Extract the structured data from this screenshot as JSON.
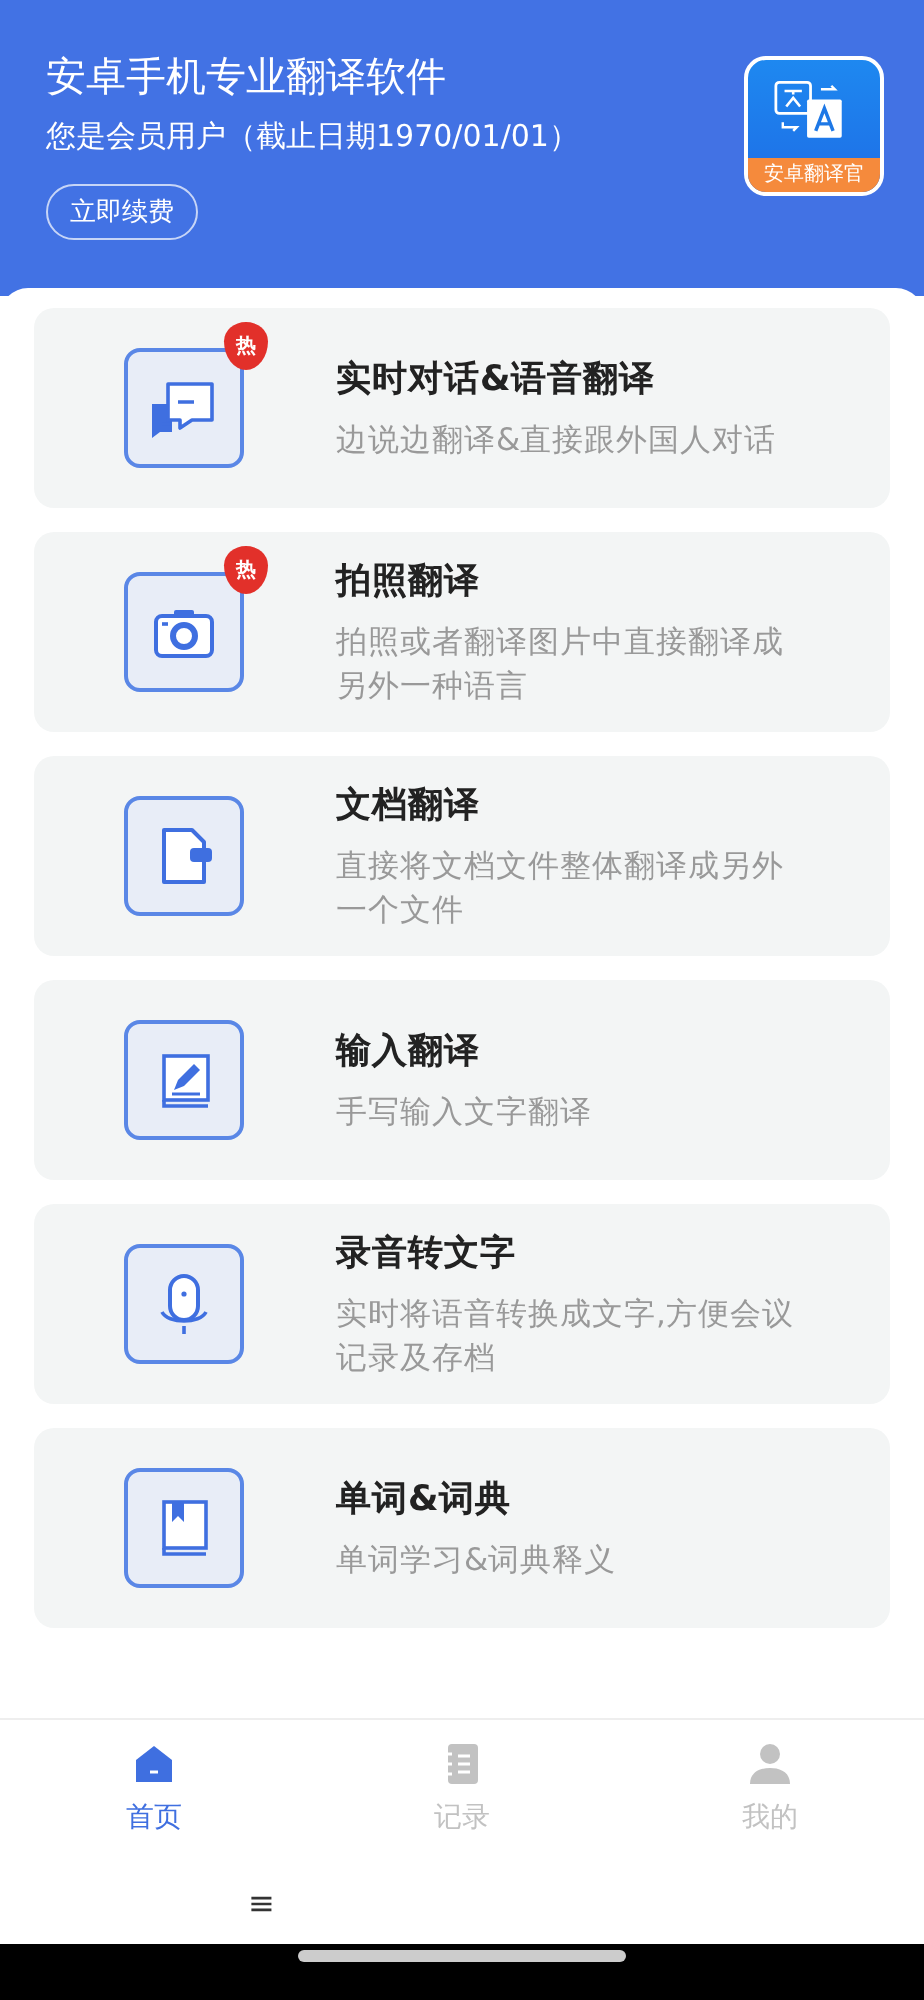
{
  "header": {
    "title": "安卓手机专业翻译软件",
    "subtitle": "您是会员用户（截止日期1970/01/01）",
    "renew_button": "立即续费",
    "app_logo_label": "安卓翻译官"
  },
  "features": [
    {
      "hot": true,
      "hot_label": "热",
      "title": "实时对话&语音翻译",
      "description": "边说边翻译&直接跟外国人对话"
    },
    {
      "hot": true,
      "hot_label": "热",
      "title": "拍照翻译",
      "description": "拍照或者翻译图片中直接翻译成另外一种语言"
    },
    {
      "hot": false,
      "title": "文档翻译",
      "description": "直接将文档文件整体翻译成另外一个文件"
    },
    {
      "hot": false,
      "title": "输入翻译",
      "description": "手写输入文字翻译"
    },
    {
      "hot": false,
      "title": "录音转文字",
      "description": "实时将语音转换成文字,方便会议记录及存档"
    },
    {
      "hot": false,
      "title": "单词&词典",
      "description": "单词学习&词典释义"
    }
  ],
  "tab_bar": [
    {
      "label": "首页",
      "selected": true
    },
    {
      "label": "记录",
      "selected": false
    },
    {
      "label": "我的",
      "selected": false
    }
  ],
  "system_nav": {
    "menu_glyph": "≡"
  }
}
